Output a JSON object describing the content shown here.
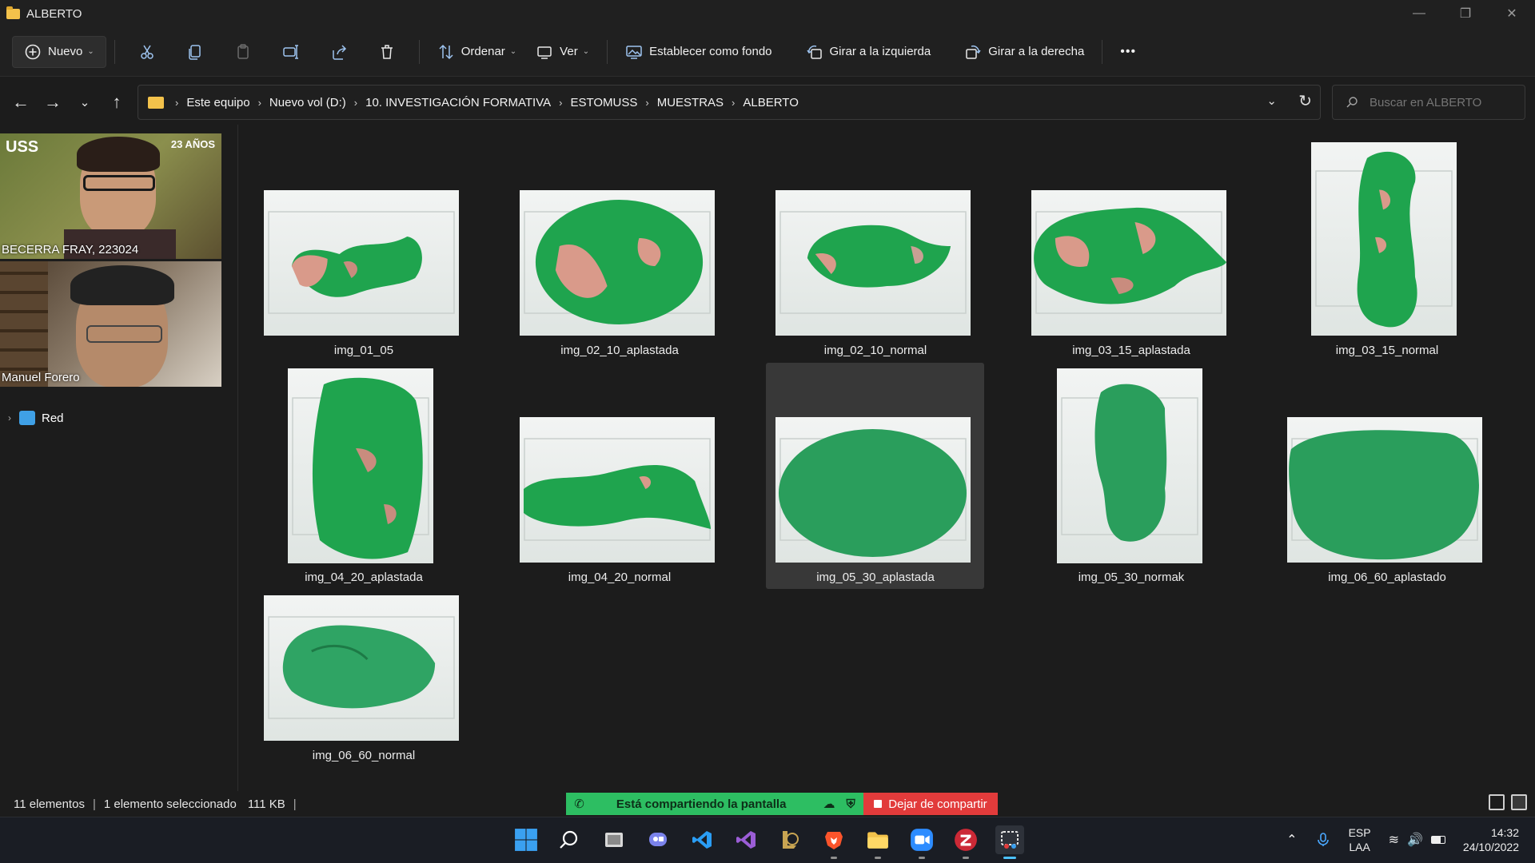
{
  "window": {
    "title": "ALBERTO"
  },
  "toolbar": {
    "new_label": "Nuevo",
    "sort_label": "Ordenar",
    "view_label": "Ver",
    "set_background_label": "Establecer como fondo",
    "rotate_left_label": "Girar a la izquierda",
    "rotate_right_label": "Girar a la derecha",
    "more_label": "•••"
  },
  "breadcrumb": [
    "Este equipo",
    "Nuevo vol (D:)",
    "10. INVESTIGACIÓN FORMATIVA",
    "ESTOMUSS",
    "MUESTRAS",
    "ALBERTO"
  ],
  "search": {
    "placeholder": "Buscar en ALBERTO"
  },
  "video": {
    "participant1": "BECERRA FRAY, 223024",
    "participant2": "Manuel Forero",
    "logo_text": "USS",
    "badge_text": "23 AÑOS"
  },
  "navpane": {
    "network_label": "Red"
  },
  "files": [
    {
      "name": "img_01_05"
    },
    {
      "name": "img_02_10_aplastada"
    },
    {
      "name": "img_02_10_normal"
    },
    {
      "name": "img_03_15_aplastada"
    },
    {
      "name": "img_03_15_normal"
    },
    {
      "name": "img_04_20_aplastada"
    },
    {
      "name": "img_04_20_normal"
    },
    {
      "name": "img_05_30_aplastada",
      "selected": true
    },
    {
      "name": "img_05_30_normak"
    },
    {
      "name": "img_06_60_aplastado"
    },
    {
      "name": "img_06_60_normal"
    }
  ],
  "status": {
    "count": "11 elementos",
    "selection": "1 elemento seleccionado",
    "size": "111 KB"
  },
  "share": {
    "sharing_text": "Está compartiendo la pantalla",
    "stop_text": "Dejar de compartir"
  },
  "tray": {
    "lang1": "ESP",
    "lang2": "LAA",
    "time": "14:32",
    "date": "24/10/2022"
  },
  "colors": {
    "accent_green": "#2dbe62",
    "stop_red": "#e23b3b",
    "sample_green": "#1fa44e",
    "sample_pink": "#d99a8a"
  }
}
